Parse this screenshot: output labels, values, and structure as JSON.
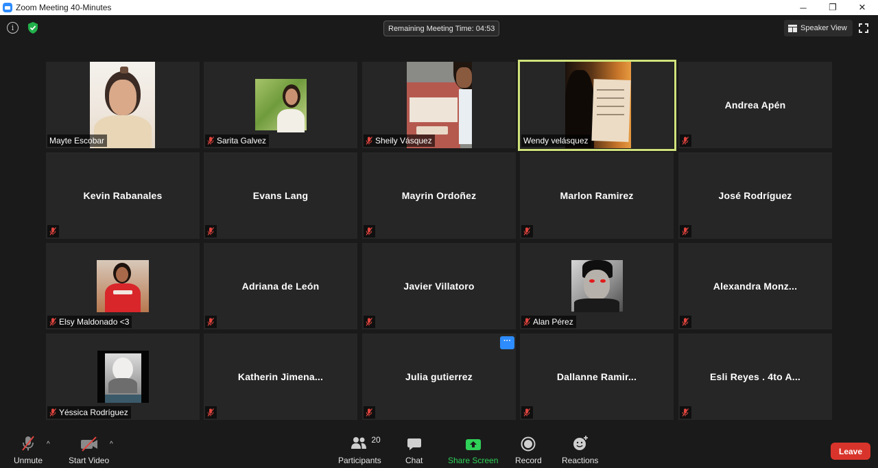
{
  "window": {
    "title": "Zoom Meeting 40-Minutes",
    "controls": {
      "minimize": "─",
      "restore": "❐",
      "close": "✕"
    }
  },
  "topbar": {
    "info_glyph": "i",
    "timer_text": "Remaining Meeting Time: 04:53",
    "view_label": "Speaker View"
  },
  "colors": {
    "active_speaker": "#cfe27b",
    "accent": "#2d8cff",
    "leave": "#d9342b",
    "share": "#2fd158",
    "muted_mic": "#e0443e"
  },
  "participants": [
    {
      "name": "Mayte Escobar",
      "video": true,
      "muted": false
    },
    {
      "name": "Sarita Galvez",
      "video": true,
      "muted": true
    },
    {
      "name": "Sheily Vásquez",
      "video": true,
      "muted": true
    },
    {
      "name": "Wendy velásquez",
      "video": true,
      "muted": false,
      "active_speaker": true
    },
    {
      "name": "Andrea Apén",
      "video": false,
      "muted": true
    },
    {
      "name": "Kevin Rabanales",
      "video": false,
      "muted": true
    },
    {
      "name": "Evans Lang",
      "video": false,
      "muted": true
    },
    {
      "name": "Mayrin Ordoñez",
      "video": false,
      "muted": true
    },
    {
      "name": "Marlon Ramirez",
      "video": false,
      "muted": true
    },
    {
      "name": "José Rodríguez",
      "video": false,
      "muted": true
    },
    {
      "name": "Elsy Maldonado <3",
      "video": true,
      "muted": true
    },
    {
      "name": "Adriana de León",
      "video": false,
      "muted": true
    },
    {
      "name": "Javier Villatoro",
      "video": false,
      "muted": true
    },
    {
      "name": "Alan Pérez",
      "video": true,
      "muted": true
    },
    {
      "name": "Alexandra  Monz...",
      "video": false,
      "muted": true
    },
    {
      "name": "Yéssica Rodríguez",
      "video": true,
      "muted": true
    },
    {
      "name": "Katherin  Jimena...",
      "video": false,
      "muted": true
    },
    {
      "name": "Julia gutierrez",
      "video": false,
      "muted": true,
      "more_menu": "···"
    },
    {
      "name": "Dallanne   Ramir...",
      "video": false,
      "muted": true
    },
    {
      "name": "Esli Reyes . 4to A...",
      "video": false,
      "muted": true
    }
  ],
  "toolbar": {
    "unmute_label": "Unmute",
    "start_video_label": "Start Video",
    "participants_label": "Participants",
    "participants_count": "20",
    "chat_label": "Chat",
    "share_label": "Share Screen",
    "record_label": "Record",
    "reactions_label": "Reactions",
    "leave_label": "Leave",
    "caret_glyph": "^"
  }
}
